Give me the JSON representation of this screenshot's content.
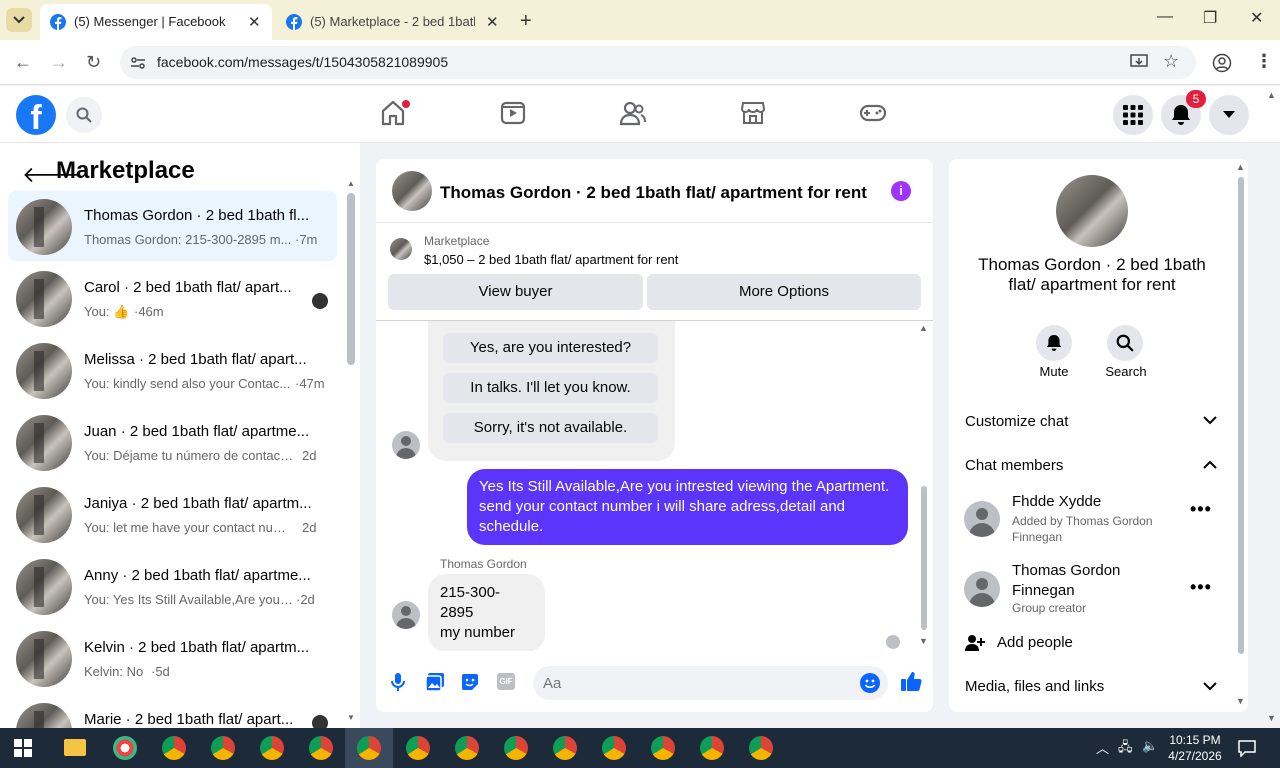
{
  "browser": {
    "tabs": [
      {
        "title": "(5) Messenger | Facebook",
        "active": true
      },
      {
        "title": "(5) Marketplace - 2 bed 1bath fl",
        "active": false
      }
    ],
    "url": "facebook.com/messages/t/1504305821089905"
  },
  "header": {
    "notifications_count": "5"
  },
  "left_panel": {
    "title": "Marketplace",
    "conversations": [
      {
        "name": "Thomas Gordon · 2 bed 1bath fl...",
        "preview": "Thomas Gordon: 215-300-2895 m...",
        "time": "·7m"
      },
      {
        "name": "Carol · 2 bed 1bath flat/ apart...",
        "preview": "You: 👍",
        "time": "·46m"
      },
      {
        "name": "Melissa · 2 bed 1bath flat/ apart...",
        "preview": "You: kindly send also your Contac...",
        "time": "·47m"
      },
      {
        "name": "Juan · 2 bed 1bath flat/ apartme...",
        "preview": "You: Déjame tu número de contact...",
        "time": "2d"
      },
      {
        "name": "Janiya · 2 bed 1bath flat/ apartm...",
        "preview": "You: let me have your contact num...",
        "time": "2d"
      },
      {
        "name": "Anny · 2 bed 1bath flat/ apartme...",
        "preview": "You: Yes Its Still Available,Are you in...",
        "time": "·2d"
      },
      {
        "name": "Kelvin · 2 bed 1bath flat/ apartm...",
        "preview": "Kelvin: No",
        "time": "·5d"
      },
      {
        "name": "Marie · 2 bed 1bath flat/ apart...",
        "preview": "",
        "time": ""
      }
    ]
  },
  "chat": {
    "title": "Thomas Gordon · 2 bed 1bath flat/ apartment for rent",
    "marketplace_label": "Marketplace",
    "listing": "$1,050 – 2 bed 1bath flat/ apartment for rent",
    "view_buyer": "View buyer",
    "more_options": "More Options",
    "quick_replies": [
      "Yes, are you interested?",
      "In talks. I'll let you know.",
      "Sorry, it's not available."
    ],
    "outgoing_message": "Yes Its Still Available,Are you intrested viewing the Apartment. send your contact number i will share adress,detail and schedule.",
    "sender_name": "Thomas Gordon",
    "incoming_lines": [
      "215-300-2895",
      "my number"
    ],
    "composer_placeholder": "Aa",
    "gif_label": "GIF"
  },
  "right_panel": {
    "name": "Thomas Gordon · 2 bed 1bath flat/ apartment for rent",
    "mute": "Mute",
    "search": "Search",
    "customize_chat": "Customize chat",
    "chat_members": "Chat members",
    "members": [
      {
        "name": "Fhdde Xydde",
        "sub": "Added by Thomas Gordon Finnegan"
      },
      {
        "name": "Thomas Gordon Finnegan",
        "sub": "Group creator"
      }
    ],
    "add_people": "Add people",
    "media_files_links": "Media, files and links"
  },
  "taskbar": {
    "time": "10:15 PM",
    "date": "4/27/2026"
  },
  "colors": {
    "fb_blue": "#1877f2",
    "outgoing_bubble": "#5c35fd",
    "info_purple": "#a033ff",
    "badge_red": "#e41e3f"
  }
}
